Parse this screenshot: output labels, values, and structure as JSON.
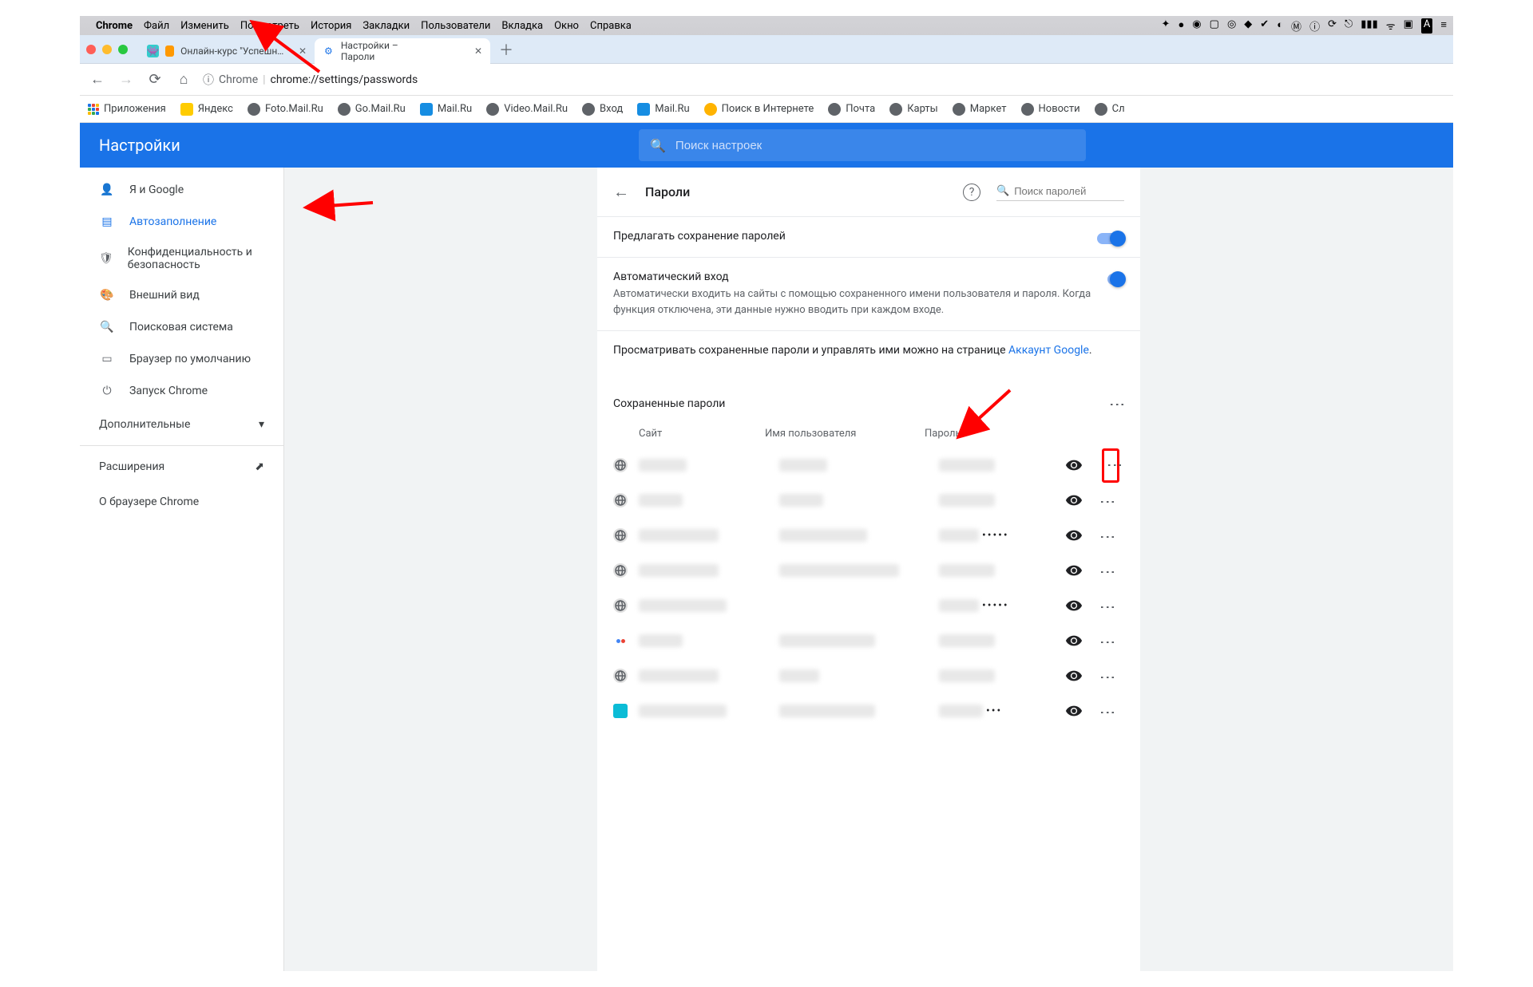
{
  "mac_menu": {
    "app": "Chrome",
    "items": [
      "Файл",
      "Изменить",
      "Посмотреть",
      "История",
      "Закладки",
      "Пользователи",
      "Вкладка",
      "Окно",
      "Справка"
    ]
  },
  "tabs": {
    "t0": {
      "title": "Онлайн-курс \"Успешный пол..."
    },
    "t1": {
      "title": "Настройки – Пароли"
    }
  },
  "omnibox": {
    "prefix": "Chrome",
    "url": "chrome://settings/passwords"
  },
  "bookmarks": [
    "Приложения",
    "Яндекс",
    "Foto.Mail.Ru",
    "Go.Mail.Ru",
    "Mail.Ru",
    "Video.Mail.Ru",
    "Вход",
    "Mail.Ru",
    "Поиск в Интернете",
    "Почта",
    "Карты",
    "Маркет",
    "Новости",
    "Сл"
  ],
  "settings": {
    "title": "Настройки",
    "search_placeholder": "Поиск настроек",
    "sidebar": [
      {
        "label": "Я и Google"
      },
      {
        "label": "Автозаполнение"
      },
      {
        "label": "Конфиденциальность и безопасность"
      },
      {
        "label": "Внешний вид"
      },
      {
        "label": "Поисковая система"
      },
      {
        "label": "Браузер по умолчанию"
      },
      {
        "label": "Запуск Chrome"
      }
    ],
    "advanced": "Дополнительные",
    "extensions": "Расширения",
    "about": "О браузере Chrome"
  },
  "panel": {
    "title": "Пароли",
    "search_placeholder": "Поиск паролей",
    "offer_save": "Предлагать сохранение паролей",
    "auto_login_title": "Автоматический вход",
    "auto_login_desc": "Автоматически входить на сайты с помощью сохраненного имени пользователя и пароля. Когда функция отключена, эти данные нужно вводить при каждом входе.",
    "manage_text": "Просматривать сохраненные пароли и управлять ими можно на странице ",
    "manage_link": "Аккаунт Google",
    "saved_title": "Сохраненные пароли",
    "cols": {
      "site": "Сайт",
      "user": "Имя пользователя",
      "pw": "Пароль"
    },
    "rows": [
      {
        "dots": ""
      },
      {
        "dots": ""
      },
      {
        "dots": "•••••"
      },
      {
        "dots": ""
      },
      {
        "dots": "•••••"
      },
      {
        "dots": ""
      },
      {
        "dots": ""
      },
      {
        "dots": "•••"
      },
      {
        "dots": ""
      }
    ]
  },
  "colors": {
    "accent": "#1a73e8",
    "red": "#ff0000"
  }
}
